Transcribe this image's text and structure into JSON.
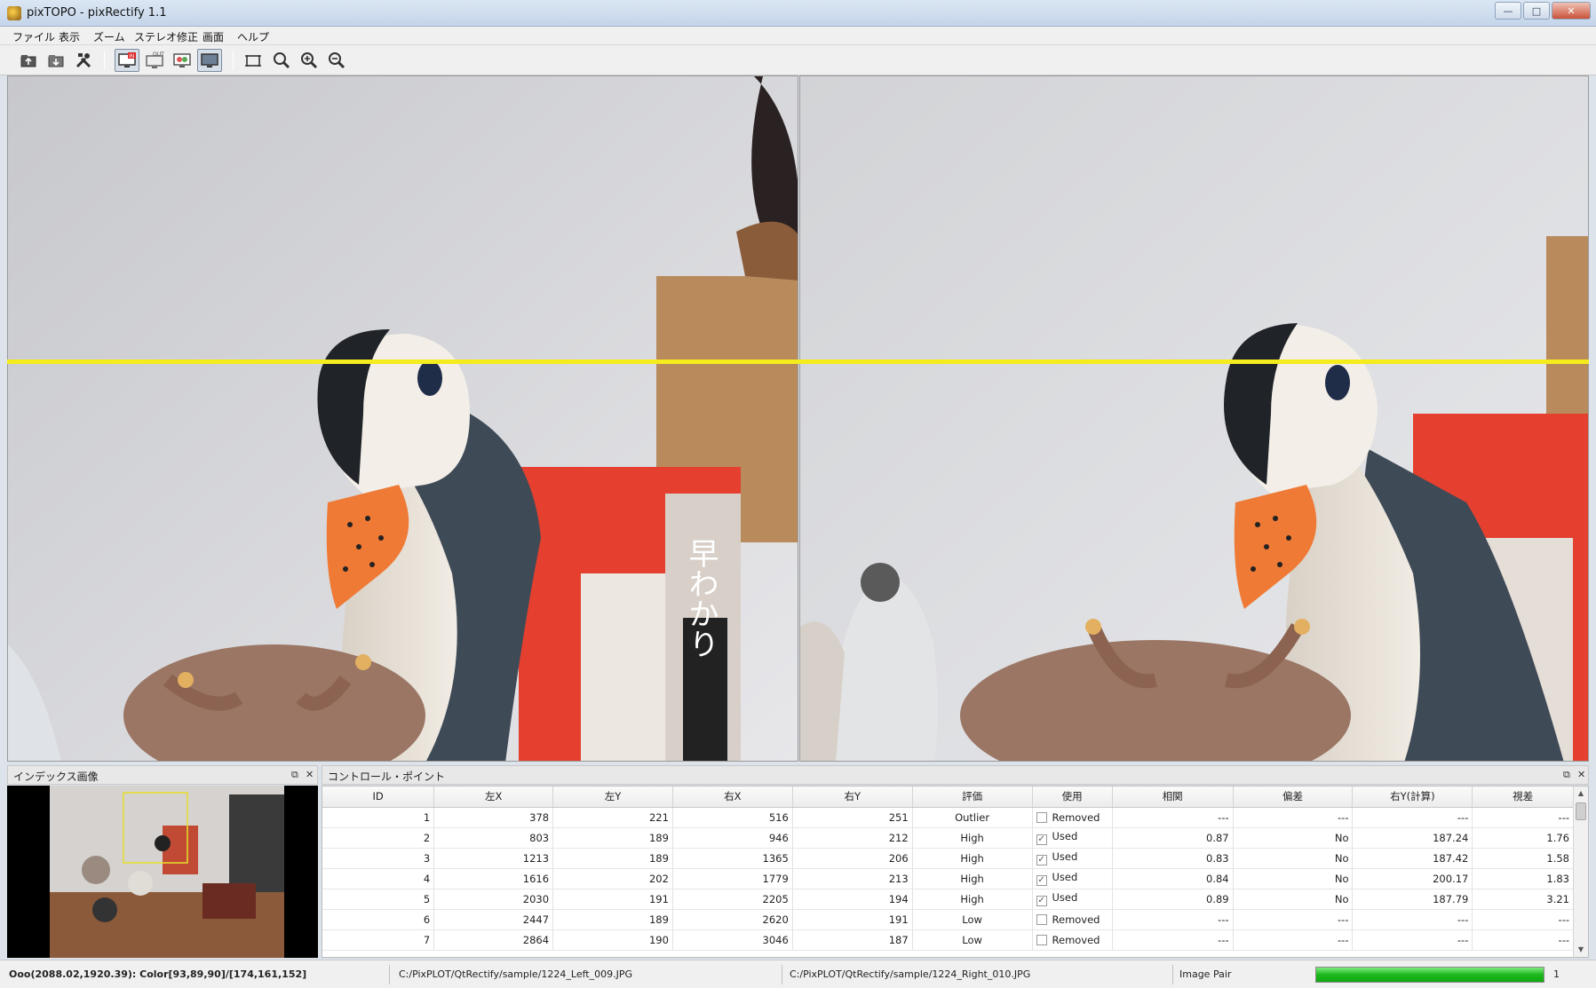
{
  "window": {
    "title": "pixTOPO - pixRectify 1.1",
    "controls": {
      "minimize": "—",
      "maximize": "□",
      "close": "✕"
    }
  },
  "menu": {
    "items": [
      {
        "label": "ファイル"
      },
      {
        "label": "表示"
      },
      {
        "label": "ズーム"
      },
      {
        "label": "ステレオ修正"
      },
      {
        "label": "画面"
      },
      {
        "label": "ヘルプ"
      }
    ]
  },
  "toolbar": {
    "buttons": [
      {
        "icon": "open-folder-icon"
      },
      {
        "icon": "save-icon"
      },
      {
        "icon": "tools-icon"
      },
      {
        "icon": "monitor-in-icon",
        "active": true,
        "badge": "IN"
      },
      {
        "icon": "monitor-out-icon",
        "badge": "OUT"
      },
      {
        "icon": "monitor-compare-icon"
      },
      {
        "icon": "monitor-display-icon",
        "active": true
      },
      {
        "icon": "fit-window-icon"
      },
      {
        "icon": "zoom-actual-icon"
      },
      {
        "icon": "zoom-in-icon"
      },
      {
        "icon": "zoom-out-icon"
      }
    ]
  },
  "colors": {
    "epipolar_line": "#f4ec1c",
    "progress": "#1db81d"
  },
  "index_panel": {
    "title": "インデックス画像"
  },
  "control_points": {
    "title": "コントロール・ポイント",
    "columns": [
      "ID",
      "左X",
      "左Y",
      "右X",
      "右Y",
      "評価",
      "使用",
      "相関",
      "偏差",
      "右Y(計算)",
      "視差"
    ],
    "rows": [
      {
        "id": "1",
        "lx": "378",
        "ly": "221",
        "rx": "516",
        "ry": "251",
        "eval": "Outlier",
        "checked": false,
        "use": "Removed",
        "corr": "---",
        "dev": "---",
        "ry_calc": "---",
        "parallax": "---"
      },
      {
        "id": "2",
        "lx": "803",
        "ly": "189",
        "rx": "946",
        "ry": "212",
        "eval": "High",
        "checked": true,
        "use": "Used",
        "corr": "0.87",
        "dev": "No",
        "ry_calc": "187.24",
        "parallax": "1.76"
      },
      {
        "id": "3",
        "lx": "1213",
        "ly": "189",
        "rx": "1365",
        "ry": "206",
        "eval": "High",
        "checked": true,
        "use": "Used",
        "corr": "0.83",
        "dev": "No",
        "ry_calc": "187.42",
        "parallax": "1.58"
      },
      {
        "id": "4",
        "lx": "1616",
        "ly": "202",
        "rx": "1779",
        "ry": "213",
        "eval": "High",
        "checked": true,
        "use": "Used",
        "corr": "0.84",
        "dev": "No",
        "ry_calc": "200.17",
        "parallax": "1.83"
      },
      {
        "id": "5",
        "lx": "2030",
        "ly": "191",
        "rx": "2205",
        "ry": "194",
        "eval": "High",
        "checked": true,
        "use": "Used",
        "corr": "0.89",
        "dev": "No",
        "ry_calc": "187.79",
        "parallax": "3.21"
      },
      {
        "id": "6",
        "lx": "2447",
        "ly": "189",
        "rx": "2620",
        "ry": "191",
        "eval": "Low",
        "checked": false,
        "use": "Removed",
        "corr": "---",
        "dev": "---",
        "ry_calc": "---",
        "parallax": "---"
      },
      {
        "id": "7",
        "lx": "2864",
        "ly": "190",
        "rx": "3046",
        "ry": "187",
        "eval": "Low",
        "checked": false,
        "use": "Removed",
        "corr": "---",
        "dev": "---",
        "ry_calc": "---",
        "parallax": "---"
      }
    ]
  },
  "status": {
    "coords": "Ooo(2088.02,1920.39): Color[93,89,90]/[174,161,152]",
    "left_file": "C:/PixPLOT/QtRectify/sample/1224_Left_009.JPG",
    "right_file": "C:/PixPLOT/QtRectify/sample/1224_Right_010.JPG",
    "mode": "Image Pair",
    "progress_fraction": 1.0,
    "count": "1"
  }
}
